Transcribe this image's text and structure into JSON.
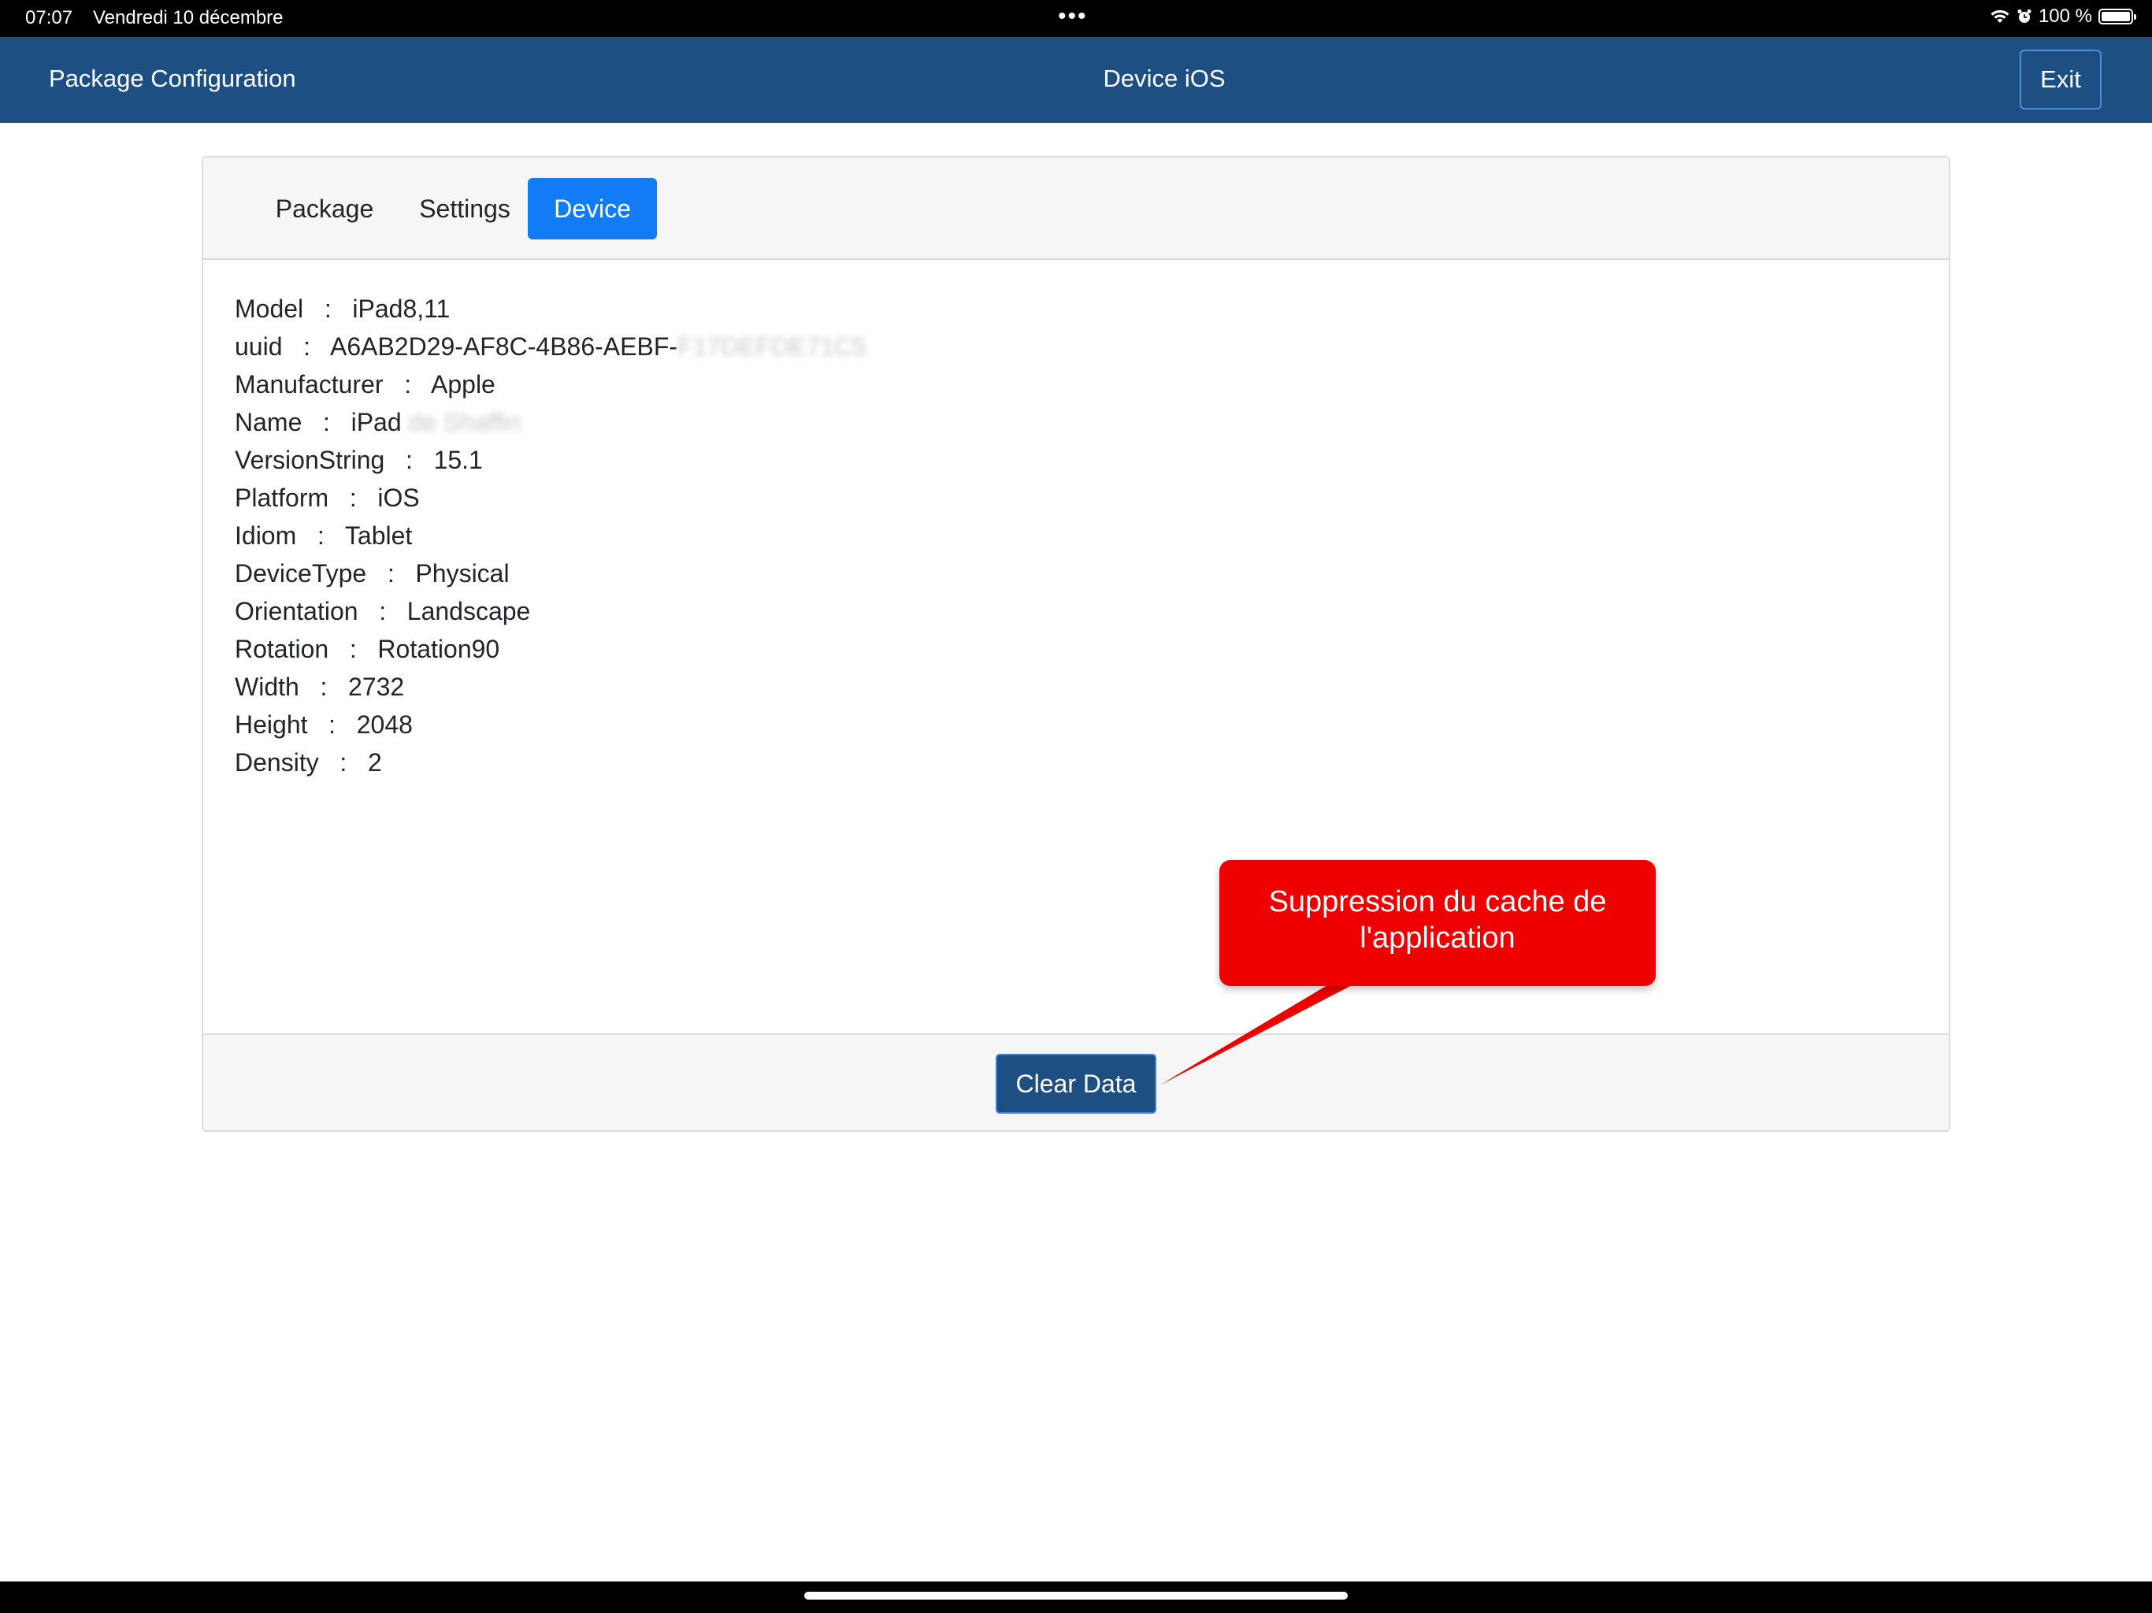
{
  "status_bar": {
    "time": "07:07",
    "date": "Vendredi 10 décembre",
    "battery": "100 %",
    "wifi_icon": "wifi-icon",
    "alarm_icon": "alarm-icon"
  },
  "nav": {
    "left_title": "Package Configuration",
    "center_title": "Device iOS",
    "exit_label": "Exit"
  },
  "tabs": [
    {
      "label": "Package"
    },
    {
      "label": "Settings"
    },
    {
      "label": "Device",
      "active": true
    }
  ],
  "device_info": [
    {
      "key": "Model",
      "value": "iPad8,11"
    },
    {
      "key": "uuid",
      "value": "A6AB2D29-AF8C-4B86-AEBF-",
      "blurred": "F17DEFDE71C5"
    },
    {
      "key": "Manufacturer",
      "value": "Apple"
    },
    {
      "key": "Name",
      "value": "iPad",
      "blurred": "de Shaffin"
    },
    {
      "key": "VersionString",
      "value": "15.1"
    },
    {
      "key": "Platform",
      "value": "iOS"
    },
    {
      "key": "Idiom",
      "value": "Tablet"
    },
    {
      "key": "DeviceType",
      "value": "Physical"
    },
    {
      "key": "Orientation",
      "value": "Landscape"
    },
    {
      "key": "Rotation",
      "value": "Rotation90"
    },
    {
      "key": "Width",
      "value": "2732"
    },
    {
      "key": "Height",
      "value": "2048"
    },
    {
      "key": "Density",
      "value": "2"
    }
  ],
  "footer": {
    "clear_label": "Clear Data"
  },
  "callout": {
    "text": "Suppression du cache de l'application",
    "color": "#ee0000"
  },
  "colors": {
    "nav_bg": "#1d4f82",
    "active_tab": "#117cf5"
  }
}
